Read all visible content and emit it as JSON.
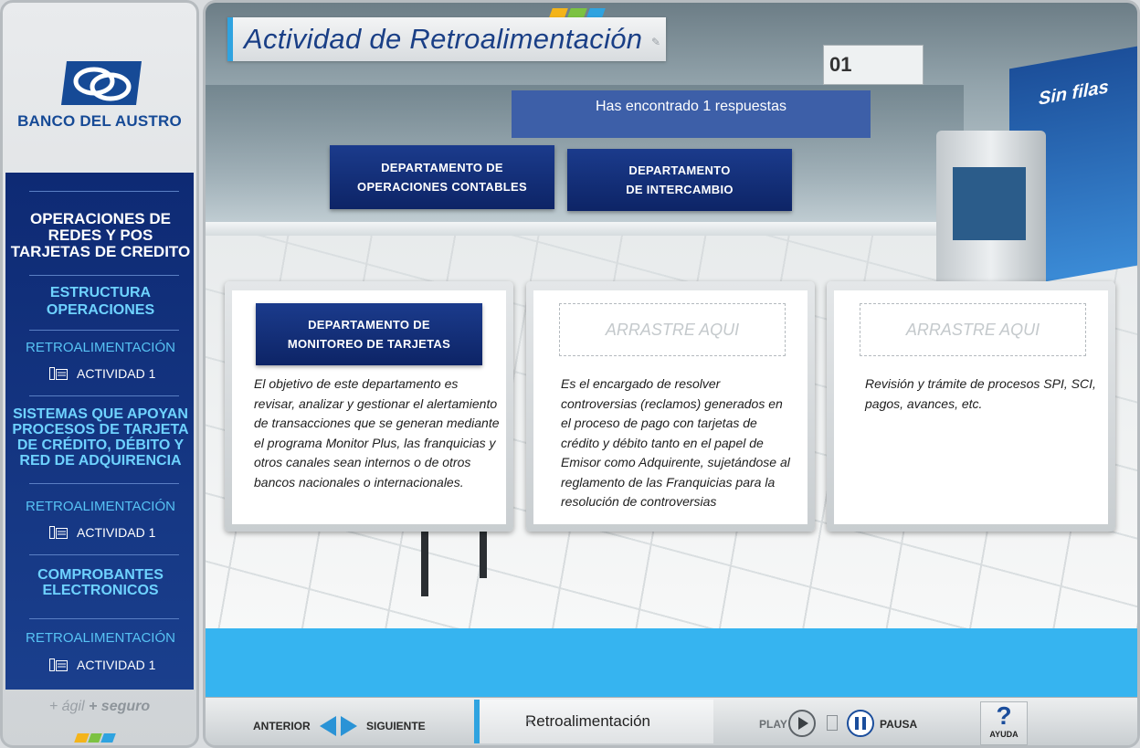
{
  "colors": {
    "navy": "#0e2a74",
    "accent_blue": "#2fa3e0",
    "light_blue": "#6ed2ff",
    "floor_band": "#36b4f0"
  },
  "sidebar": {
    "logo_text": "BANCO DEL AUSTRO",
    "slogan_1": "+ ágil",
    "slogan_2": "+ seguro",
    "sections": [
      {
        "heading": "OPERACIONES DE REDES Y POS TARJETAS DE CREDITO"
      },
      {
        "heading": "ESTRUCTURA OPERACIONES"
      },
      {
        "feedback_label": "RETROALIMENTACIÓN",
        "activity": "ACTIVIDAD 1"
      },
      {
        "heading": "SISTEMAS QUE APOYAN PROCESOS DE TARJETA DE CRÉDITO, DÉBITO Y RED DE ADQUIRENCIA"
      },
      {
        "feedback_label": "RETROALIMENTACIÓN",
        "activity": "ACTIVIDAD 1"
      },
      {
        "heading": "COMPROBANTES ELECTRONICOS"
      },
      {
        "feedback_label": "RETROALIMENTACIÓN",
        "activity": "ACTIVIDAD 1"
      }
    ]
  },
  "main": {
    "title": "Actividad de Retroalimentación",
    "feedback_message": "Has encontrado 1 respuestas",
    "scene": {
      "caja_number": "01",
      "banner_text": "Sin filas"
    },
    "draggables": [
      {
        "label_line1": "DEPARTAMENTO DE",
        "label_line2": "OPERACIONES CONTABLES"
      },
      {
        "label_line1": "DEPARTAMENTO",
        "label_line2": "DE INTERCAMBIO"
      }
    ],
    "cards": [
      {
        "placed_line1": "DEPARTAMENTO DE",
        "placed_line2": "MONITOREO DE TARJETAS",
        "description": "El objetivo de este departamento es revisar, analizar y gestionar el alertamiento de transacciones que se generan mediante el  programa Monitor Plus, las franquicias y otros canales sean internos o de otros bancos nacionales o internacionales."
      },
      {
        "drop_placeholder": "ARRASTRE AQUI",
        "description": "Es el encargado de resolver controversias (reclamos) generados en el proceso de pago con tarjetas de crédito y débito tanto en el papel de Emisor como Adquirente, sujetándose al reglamento de las Franquicias para la resolución de controversias"
      },
      {
        "drop_placeholder": "ARRASTRE AQUI",
        "description": "Revisión y trámite de procesos SPI, SCI, pagos, avances, etc."
      }
    ]
  },
  "bottom_bar": {
    "prev_label": "ANTERIOR",
    "next_label": "SIGUIENTE",
    "section_label": "Retroalimentación",
    "play_label": "PLAY",
    "pause_label": "PAUSA",
    "help_label": "AYUDA",
    "help_symbol": "?"
  }
}
